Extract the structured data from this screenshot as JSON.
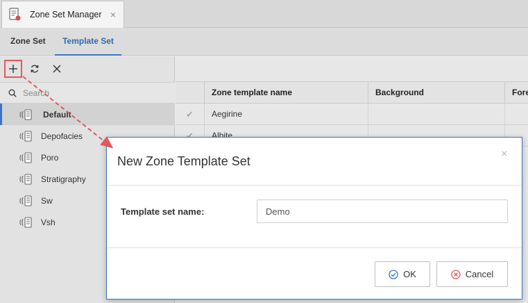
{
  "window": {
    "tab_title": "Zone Set Manager",
    "tab_close": "×",
    "tab_icon": "zone-set-manager-icon"
  },
  "subtabs": [
    {
      "label": "Zone Set",
      "active": false
    },
    {
      "label": "Template Set",
      "active": true
    }
  ],
  "toolbar": {
    "add_icon": "plus-icon",
    "refresh_icon": "refresh-icon",
    "delete_icon": "close-icon"
  },
  "search": {
    "placeholder": "Search"
  },
  "template_sets": [
    {
      "label": "Default",
      "selected": true
    },
    {
      "label": "Depofacies",
      "selected": false
    },
    {
      "label": "Poro",
      "selected": false
    },
    {
      "label": "Stratigraphy",
      "selected": false
    },
    {
      "label": "Sw",
      "selected": false
    },
    {
      "label": "Vsh",
      "selected": false
    }
  ],
  "grid": {
    "columns": [
      "",
      "Zone template name",
      "Background",
      "Fore"
    ],
    "rows": [
      {
        "checked": true,
        "name": "Aegirine",
        "background": ""
      },
      {
        "checked": true,
        "name": "Albite",
        "background": ""
      }
    ]
  },
  "dialog": {
    "title": "New Zone Template Set",
    "close": "×",
    "field_label": "Template set name:",
    "field_value": "Demo",
    "ok_label": "OK",
    "cancel_label": "Cancel"
  },
  "colors": {
    "accent": "#3a75c4",
    "annotation": "#e05a5a",
    "cancel_icon": "#e05a5a"
  }
}
